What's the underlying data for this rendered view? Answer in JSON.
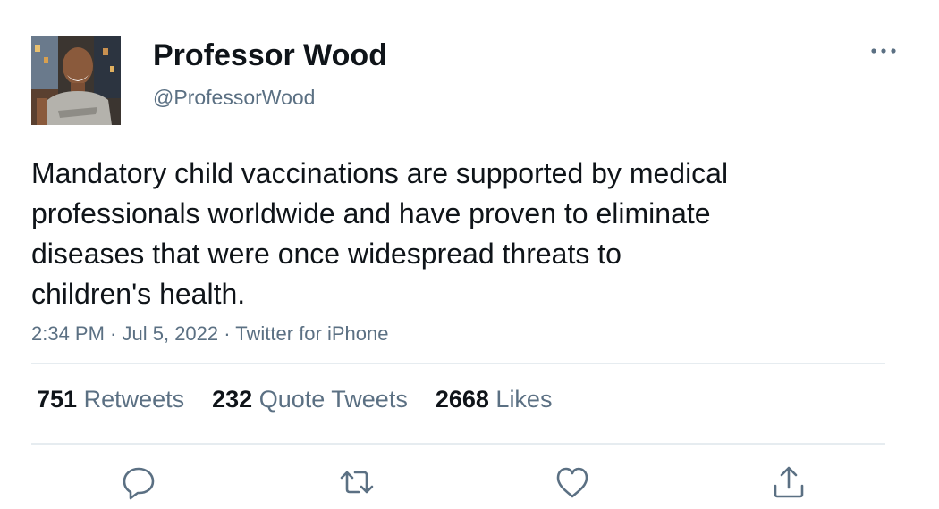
{
  "tweet": {
    "author": {
      "display_name": "Professor Wood",
      "handle": "@ProfessorWood"
    },
    "text": "Mandatory child vaccinations are supported by medical\nprofessionals worldwide and have proven to eliminate\ndiseases that were once widespread threats to\nchildren's health.",
    "time": "2:34 PM",
    "separator": " · ",
    "date": "Jul 5, 2022",
    "source": "Twitter for iPhone"
  },
  "stats": {
    "retweets": {
      "count": "751",
      "label": "Retweets"
    },
    "quotes": {
      "count": "232",
      "label": "Quote Tweets"
    },
    "likes": {
      "count": "2668",
      "label": "Likes"
    }
  },
  "actions": [
    {
      "icon": "reply-icon"
    },
    {
      "icon": "retweet-icon"
    },
    {
      "icon": "like-icon"
    },
    {
      "icon": "share-icon"
    }
  ],
  "colors": {
    "text": "#0f1419",
    "secondary": "#5b7083",
    "divider": "#e6ecf0"
  }
}
